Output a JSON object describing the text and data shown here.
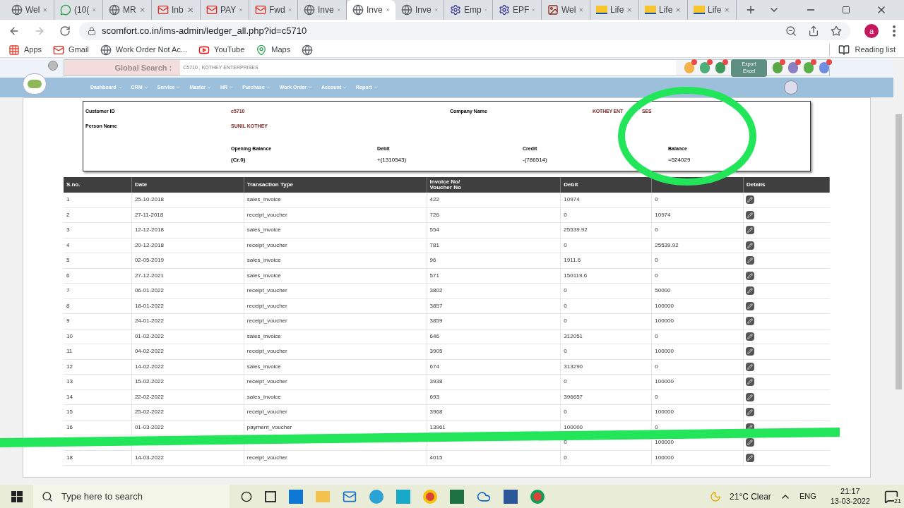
{
  "browser": {
    "tabs": [
      {
        "title": "Wel",
        "kind": "globe",
        "selected": false
      },
      {
        "title": "(10(",
        "kind": "chat",
        "selected": false
      },
      {
        "title": "MR",
        "kind": "globe",
        "selected": false
      },
      {
        "title": "Inb",
        "kind": "mail",
        "selected": false
      },
      {
        "title": "PAY",
        "kind": "mail",
        "selected": false
      },
      {
        "title": "Fwd",
        "kind": "mail",
        "selected": false
      },
      {
        "title": "Inve",
        "kind": "globe",
        "selected": false
      },
      {
        "title": "Inve",
        "kind": "globe",
        "selected": true
      },
      {
        "title": "Inve",
        "kind": "globe",
        "selected": false
      },
      {
        "title": "Emp",
        "kind": "emblem",
        "selected": false
      },
      {
        "title": "EPF",
        "kind": "emblem",
        "selected": false
      },
      {
        "title": "Wel",
        "kind": "photo",
        "selected": false
      },
      {
        "title": "Life",
        "kind": "logo",
        "selected": false
      },
      {
        "title": "Life",
        "kind": "logo",
        "selected": false
      },
      {
        "title": "Life",
        "kind": "logo",
        "selected": false
      }
    ],
    "url": "scomfort.co.in/ims-admin/ledger_all.php?id=c5710",
    "profile_initial": "a",
    "bookmarks": [
      {
        "label": "Apps",
        "kind": "apps"
      },
      {
        "label": "Gmail",
        "kind": "mail"
      },
      {
        "label": "Work Order Not Ac...",
        "kind": "globe"
      },
      {
        "label": "YouTube",
        "kind": "youtube"
      },
      {
        "label": "Maps",
        "kind": "maps"
      },
      {
        "kind": "globe"
      }
    ],
    "reading_list": "Reading list"
  },
  "header": {
    "search_label": "Global Search :",
    "search_value": "C5710 , KOTHEY ENTERPRISES",
    "export_button": "Export Excel",
    "icons_left": [
      {
        "color": "#f3b34a"
      },
      {
        "color": "#4caf7a"
      },
      {
        "color": "#3d9a5a"
      }
    ],
    "icons_right": [
      {
        "color": "#5aa845"
      },
      {
        "color": "#8a7fc0"
      },
      {
        "color": "#58b04a"
      },
      {
        "color": "#6f8fe0"
      }
    ],
    "nav": [
      "Dashboard",
      "CRM",
      "Service",
      "Master",
      "HR",
      "Purchase",
      "Work Order",
      "Account",
      "Report"
    ]
  },
  "customer": {
    "id_label": "Customer ID",
    "id": "c5710",
    "company_label": "Company Name",
    "company_visible_parts": [
      "KOTHEY ENT",
      "SES"
    ],
    "person_label": "Person Name",
    "person": "SUNIL KOTHEY",
    "summary": [
      {
        "label": "Opening Balance",
        "value": "(Cr.0)"
      },
      {
        "label": "Debit",
        "value": "+(1310543)"
      },
      {
        "label": "Credit",
        "value": "-(786514)"
      },
      {
        "label": "Balance",
        "value": "=524029"
      }
    ]
  },
  "table": {
    "columns": [
      {
        "label": "S.no."
      },
      {
        "label": "Date"
      },
      {
        "label": "Transaction Type"
      },
      {
        "label": "Invoice No/\nVoucher No"
      },
      {
        "label": "Debit"
      },
      {},
      {
        "label": "Details"
      }
    ],
    "rows": [
      {
        "sno": "1",
        "date": "25-10-2018",
        "type": "sales_invoice",
        "invoice": "422",
        "debit": "10974",
        "credit": "0"
      },
      {
        "sno": "2",
        "date": "27-11-2018",
        "type": "receipt_voucher",
        "invoice": "726",
        "debit": "0",
        "credit": "10974"
      },
      {
        "sno": "3",
        "date": "12-12-2018",
        "type": "sales_invoice",
        "invoice": "554",
        "debit": "25539.92",
        "credit": "0"
      },
      {
        "sno": "4",
        "date": "20-12-2018",
        "type": "receipt_voucher",
        "invoice": "781",
        "debit": "0",
        "credit": "25539.92"
      },
      {
        "sno": "5",
        "date": "02-05-2019",
        "type": "sales_invoice",
        "invoice": "96",
        "debit": "1911.6",
        "credit": "0"
      },
      {
        "sno": "6",
        "date": "27-12-2021",
        "type": "sales_invoice",
        "invoice": "571",
        "debit": "150119.6",
        "credit": "0"
      },
      {
        "sno": "7",
        "date": "06-01-2022",
        "type": "receipt_voucher",
        "invoice": "3802",
        "debit": "0",
        "credit": "50000"
      },
      {
        "sno": "8",
        "date": "18-01-2022",
        "type": "receipt_voucher",
        "invoice": "3857",
        "debit": "0",
        "credit": "100000"
      },
      {
        "sno": "9",
        "date": "24-01-2022",
        "type": "receipt_voucher",
        "invoice": "3859",
        "debit": "0",
        "credit": "100000"
      },
      {
        "sno": "10",
        "date": "01-02-2022",
        "type": "sales_invoice",
        "invoice": "646",
        "debit": "312051",
        "credit": "0"
      },
      {
        "sno": "11",
        "date": "04-02-2022",
        "type": "receipt_voucher",
        "invoice": "3905",
        "debit": "0",
        "credit": "100000"
      },
      {
        "sno": "12",
        "date": "14-02-2022",
        "type": "sales_invoice",
        "invoice": "674",
        "debit": "313290",
        "credit": "0"
      },
      {
        "sno": "13",
        "date": "15-02-2022",
        "type": "receipt_voucher",
        "invoice": "3938",
        "debit": "0",
        "credit": "100000"
      },
      {
        "sno": "14",
        "date": "22-02-2022",
        "type": "sales_invoice",
        "invoice": "693",
        "debit": "396657",
        "credit": "0"
      },
      {
        "sno": "15",
        "date": "25-02-2022",
        "type": "receipt_voucher",
        "invoice": "3968",
        "debit": "0",
        "credit": "100000"
      },
      {
        "sno": "16",
        "date": "01-03-2022",
        "type": "payment_voucher",
        "invoice": "13961",
        "debit": "100000",
        "credit": "0"
      },
      {
        "debit": "0",
        "credit": "100000"
      },
      {
        "sno": "18",
        "date": "14-03-2022",
        "type": "receipt_voucher",
        "invoice": "4015",
        "debit": "0",
        "credit": "100000"
      }
    ]
  },
  "taskbar": {
    "search_placeholder": "Type here to search",
    "weather": "21°C Clear",
    "language": "ENG",
    "time": "21:17",
    "date": "13-03-2022",
    "notifications": "21"
  }
}
